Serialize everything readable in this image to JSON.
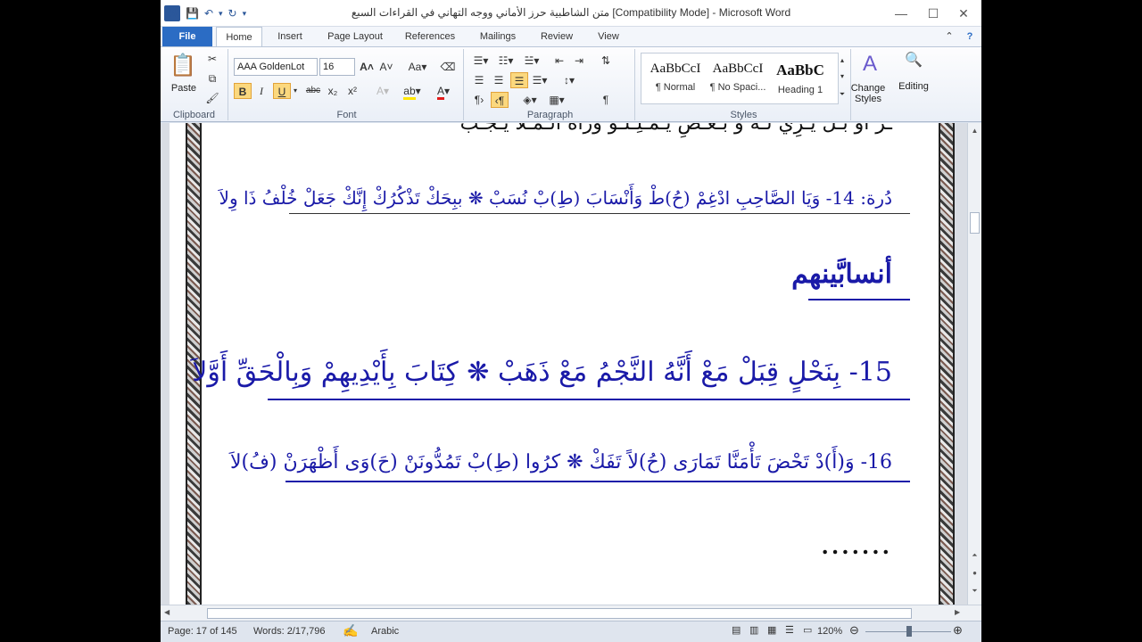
{
  "window": {
    "title": "متن الشاطبية حرز الأماني ووجه التهاني في القراءات السبع [Compatibility Mode] - Microsoft Word"
  },
  "tabs": [
    "File",
    "Home",
    "Insert",
    "Page Layout",
    "References",
    "Mailings",
    "Review",
    "View"
  ],
  "ribbon": {
    "clipboard": {
      "paste": "Paste",
      "label": "Clipboard"
    },
    "font": {
      "name": "AAA GoldenLot",
      "size": "16",
      "label": "Font"
    },
    "paragraph": {
      "label": "Paragraph"
    },
    "styles": {
      "label": "Styles",
      "items": [
        {
          "sample": "AaBbCcI",
          "name": "¶ Normal"
        },
        {
          "sample": "AaBbCcI",
          "name": "¶ No Spaci..."
        },
        {
          "sample": "AaBbC",
          "name": "Heading 1"
        }
      ],
      "change_styles": "Change Styles",
      "editing": "Editing"
    }
  },
  "document": {
    "line_top_partial": "ـرَ أوْ بَـلْ يَـرِيْ لَـهُ وَ بَـعْـضِ يُـمْـلِـلْـوَ وَرَاهُ الْـمُـلاَ يُـجُـبْ",
    "line14": "دُرة: 14- وَيَا الصَّاحِبِ ادْغِمْ (حُ)طْ وَأَنْسَابَ (طِ)بْ نُسَبْ ❋ ببِحَكْ تَذْكُرُكْ إِنَّكْ جَعَلْ خُلْفُ ذَا وِلاَ",
    "word": "أنسابَّينهم",
    "line15": "15- بِنَحْلٍ قِبَلْ مَعْ أَنَّهُ النَّجْمُ مَعْ ذَهَبْ ❋ كِتَابَ بِأَيْدِيهِمْ وَبِالْحَقِّ أَوَّلاَ",
    "line16": "16- وَ(أَ)دْ تَحْضَ تَأْمَنَّا تَمَارَى (حُ)لاً تَفَكْ ❋ كرُوا (طِ)بْ تَمُدُّونَنْ (حَ)وَى أَظْهَرَنْ (فُ)لاَ",
    "dots": "......."
  },
  "status": {
    "page": "Page: 17 of 145",
    "words": "Words: 2/17,796",
    "language": "Arabic",
    "zoom": "120%"
  },
  "colors": {
    "ribbon_blue": "#2b579a",
    "text_blue": "#1a1aa8",
    "text_red": "#e31b1b",
    "highlight": "#fbd87e"
  }
}
